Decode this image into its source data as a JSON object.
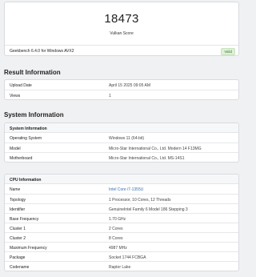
{
  "score_card": {
    "score": "18473",
    "score_label": "Vulkan Score",
    "version": "Geekbench 6.4.0 for Windows AVX2",
    "badge": "Valid"
  },
  "result_info": {
    "heading": "Result Information",
    "rows": [
      {
        "k": "Upload Date",
        "v": "April 15 2025 09:05 AM"
      },
      {
        "k": "Views",
        "v": "1"
      }
    ]
  },
  "system_info": {
    "heading": "System Information",
    "system": {
      "title": "System Information",
      "rows": [
        {
          "k": "Operating System",
          "v": "Windows 11 (64-bit)"
        },
        {
          "k": "Model",
          "v": "Micro-Star International Co., Ltd. Modern 14 F13MG"
        },
        {
          "k": "Motherboard",
          "v": "Micro-Star International Co., Ltd. MS-14S1"
        }
      ]
    },
    "cpu": {
      "title": "CPU Information",
      "rows": [
        {
          "k": "Name",
          "v": "Intel Core i7-1355U"
        },
        {
          "k": "Topology",
          "v": "1 Processor, 10 Cores, 12 Threads"
        },
        {
          "k": "Identifier",
          "v": "GenuineIntel Family 6 Model 186 Stepping 3"
        },
        {
          "k": "Base Frequency",
          "v": "1.70 GHz"
        },
        {
          "k": "Cluster 1",
          "v": "2 Cores"
        },
        {
          "k": "Cluster 2",
          "v": "8 Cores"
        },
        {
          "k": "Maximum Frequency",
          "v": "4987 MHz"
        },
        {
          "k": "Package",
          "v": "Socket 1744 FCBGA"
        },
        {
          "k": "Codename",
          "v": "Raptor Lake"
        }
      ]
    }
  }
}
